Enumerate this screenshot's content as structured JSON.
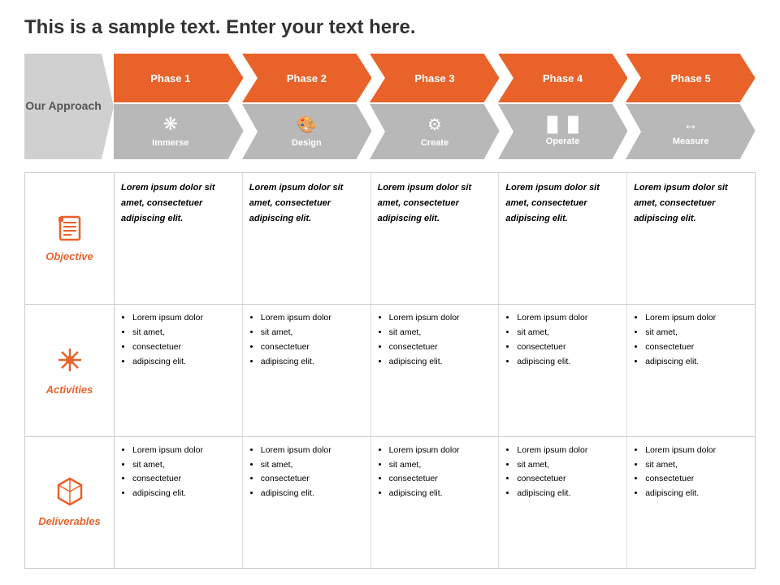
{
  "title": "This is a sample text. Enter your text here.",
  "approach": {
    "label": "Our\nApproach"
  },
  "phases": [
    {
      "id": "phase1",
      "phase_label": "Phase 1",
      "icon": "⚙",
      "icon_unicode": "🔘",
      "name": "Immerse",
      "icon_symbol": "❋"
    },
    {
      "id": "phase2",
      "phase_label": "Phase 2",
      "icon": "🎨",
      "name": "Design",
      "icon_symbol": "🎨"
    },
    {
      "id": "phase3",
      "phase_label": "Phase 3",
      "icon": "⚙",
      "name": "Create",
      "icon_symbol": "⚙"
    },
    {
      "id": "phase4",
      "phase_label": "Phase 4",
      "icon": "📊",
      "name": "Operate",
      "icon_symbol": "📊"
    },
    {
      "id": "phase5",
      "phase_label": "Phase 5",
      "icon": "↔",
      "name": "Measure",
      "icon_symbol": "↔"
    }
  ],
  "rows": [
    {
      "id": "objective",
      "icon": "📋",
      "label": "Objective",
      "type": "objective",
      "cells": [
        "Lorem ipsum dolor sit amet, consectetuer adipiscing elit.",
        "Lorem ipsum dolor sit amet, consectetuer adipiscing elit.",
        "Lorem ipsum dolor sit amet, consectetuer adipiscing elit.",
        "Lorem ipsum dolor sit amet, consectetuer adipiscing elit.",
        "Lorem ipsum dolor sit amet, consectetuer adipiscing elit."
      ]
    },
    {
      "id": "activities",
      "icon": "✦",
      "label": "Activities",
      "type": "bullets",
      "cells": [
        [
          "Lorem ipsum dolor",
          "sit amet,",
          "consectetuer",
          "adipiscing elit."
        ],
        [
          "Lorem ipsum dolor",
          "sit amet,",
          "consectetuer",
          "adipiscing elit."
        ],
        [
          "Lorem ipsum dolor",
          "sit amet,",
          "consectetuer",
          "adipiscing elit."
        ],
        [
          "Lorem ipsum dolor",
          "sit amet,",
          "consectetuer",
          "adipiscing elit."
        ],
        [
          "Lorem ipsum dolor",
          "sit amet,",
          "consectetuer",
          "adipiscing elit."
        ]
      ]
    },
    {
      "id": "deliverables",
      "icon": "⌛",
      "label": "Deliverables",
      "type": "bullets",
      "cells": [
        [
          "Lorem ipsum dolor",
          "sit amet,",
          "consectetuer",
          "adipiscing elit."
        ],
        [
          "Lorem ipsum dolor",
          "sit amet,",
          "consectetuer",
          "adipiscing elit."
        ],
        [
          "Lorem ipsum dolor",
          "sit amet,",
          "consectetuer",
          "adipiscing elit."
        ],
        [
          "Lorem ipsum dolor",
          "sit amet,",
          "consectetuer",
          "adipiscing elit."
        ],
        [
          "Lorem ipsum dolor",
          "sit amet,",
          "consectetuer",
          "adipiscing elit."
        ]
      ]
    }
  ],
  "colors": {
    "orange": "#e8622a",
    "gray": "#b8b8b8",
    "approach_gray": "#d0d0d0"
  }
}
